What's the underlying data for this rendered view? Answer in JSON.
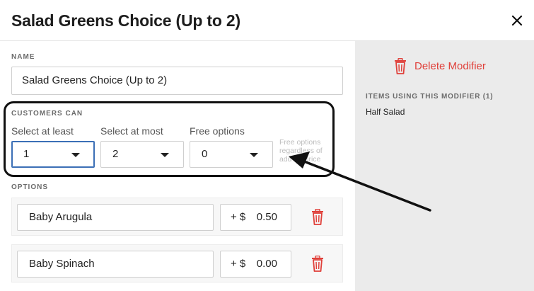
{
  "modal": {
    "title": "Salad Greens Choice (Up to 2)"
  },
  "form": {
    "name_label": "NAME",
    "name_value": "Salad Greens Choice (Up to 2)",
    "customers_can_label": "CUSTOMERS CAN",
    "select_at_least": {
      "label": "Select at least",
      "value": "1"
    },
    "select_at_most": {
      "label": "Select at most",
      "value": "2"
    },
    "free_options": {
      "label": "Free options",
      "value": "0"
    },
    "free_options_hint": "Free options regardless of add-on price",
    "options_label": "OPTIONS",
    "options": [
      {
        "name": "Baby Arugula",
        "prefix": "+ $",
        "price": "0.50"
      },
      {
        "name": "Baby Spinach",
        "prefix": "+ $",
        "price": "0.00"
      }
    ]
  },
  "sidebar": {
    "delete_label": "Delete Modifier",
    "items_using_label": "ITEMS USING THIS MODIFIER (1)",
    "items": [
      "Half Salad"
    ]
  },
  "icons": {
    "close": "close-icon",
    "trash": "trash-icon",
    "caret": "caret-down-icon"
  },
  "colors": {
    "danger": "#e0403a",
    "focus": "#3b6fb6",
    "sidebar_bg": "#ebebeb"
  }
}
